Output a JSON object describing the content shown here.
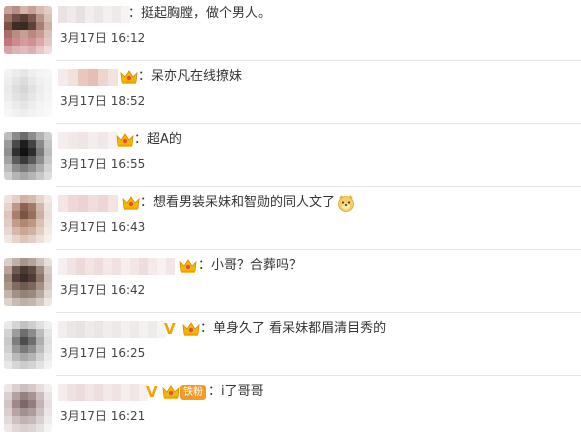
{
  "comments": [
    {
      "text": "：挺起胸膛，做个男人。",
      "time": "3月17日 16:12",
      "vip": false,
      "crown": false,
      "badge": "",
      "emoji": false
    },
    {
      "text": "：呆亦凡在线撩妹",
      "time": "3月17日 18:52",
      "vip": false,
      "crown": true,
      "badge": "",
      "emoji": false
    },
    {
      "text": "：超A的",
      "time": "3月17日 16:55",
      "vip": false,
      "crown": true,
      "badge": "",
      "emoji": false
    },
    {
      "text": "：想看男装呆妹和智勋的同人文了",
      "time": "3月17日 16:43",
      "vip": false,
      "crown": true,
      "badge": "",
      "emoji": true,
      "emoji_name": "doge-emoji"
    },
    {
      "text": "：小哥？合葬吗？",
      "time": "3月17日 16:42",
      "vip": false,
      "crown": true,
      "badge": "",
      "emoji": false
    },
    {
      "text": "：单身久了 看呆妹都眉清目秀的",
      "time": "3月17日 16:25",
      "vip": true,
      "vip_label": "V",
      "crown": true,
      "badge": "",
      "emoji": false
    },
    {
      "text": "：i了哥哥",
      "time": "3月17日 16:21",
      "vip": true,
      "vip_label": "V",
      "crown": true,
      "badge": "铁粉",
      "emoji": false
    }
  ],
  "icons": {
    "crown": "crown-icon",
    "vip": "vip-icon"
  },
  "colors": {
    "text": "#333333",
    "time": "#444444",
    "vip": "#f0a500",
    "badge": "#f59a23",
    "divider": "#e6e6e6"
  }
}
